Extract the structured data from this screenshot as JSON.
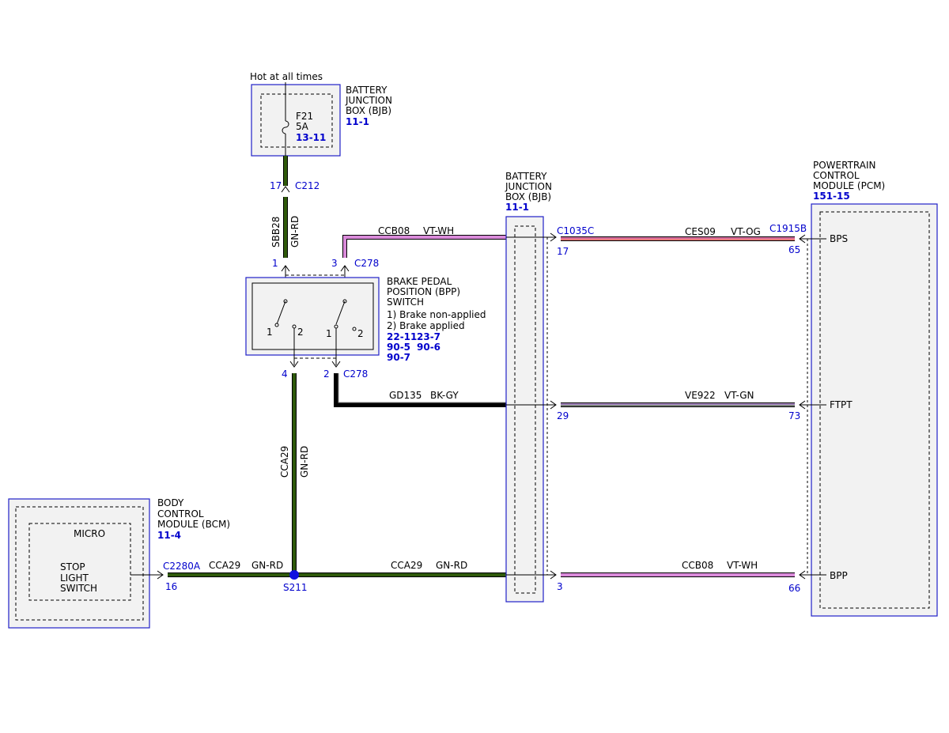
{
  "colors": {
    "gn_rd": "#2f5a0a",
    "vt_wh": "#d98ad9",
    "vt_og": "#e87a7a",
    "vt_gn": "#a686c0",
    "bk_gy": "#000000",
    "module_border": "#2020c8",
    "link_text": "#0000cc",
    "splice": "#1010e0"
  },
  "top_note": "Hot at all times",
  "bjb_top": {
    "name_lines": [
      "BATTERY",
      "JUNCTION",
      "BOX (BJB)"
    ],
    "ref": "11-1",
    "fuse": {
      "id": "F21",
      "rating": "5A",
      "ref": "13-11"
    }
  },
  "bjb_mid": {
    "name_lines": [
      "BATTERY",
      "JUNCTION",
      "BOX (BJB)"
    ],
    "ref": "11-1"
  },
  "pcm": {
    "name_lines": [
      "POWERTRAIN",
      "CONTROL",
      "MODULE (PCM)"
    ],
    "ref": "151-15",
    "pins": [
      "BPS",
      "FTPT",
      "BPP"
    ]
  },
  "bcm": {
    "name_lines": [
      "BODY",
      "CONTROL",
      "MODULE (BCM)"
    ],
    "ref": "11-4",
    "inner_label": "MICRO",
    "switch_lines": [
      "STOP",
      "LIGHT",
      "SWITCH"
    ]
  },
  "bpp": {
    "name_lines": [
      "BRAKE PEDAL",
      "POSITION (BPP)",
      "SWITCH"
    ],
    "states": [
      "1) Brake non-applied",
      "2) Brake applied"
    ],
    "refs": [
      "22-11",
      "23-7",
      "90-5",
      "90-6",
      "90-7"
    ],
    "contact_labels": [
      "1",
      "2",
      "1",
      "2"
    ]
  },
  "connectors": {
    "c212": "C212",
    "c212_pin": "17",
    "c278_top": "C278",
    "c278_pin1": "1",
    "c278_pin3": "3",
    "c278_bottom": "C278",
    "c278_pin4": "4",
    "c278_pin2": "2",
    "c1035c": "C1035C",
    "c1035c_pin17": "17",
    "c1035c_pin29": "29",
    "c1035c_pin3": "3",
    "c1915b": "C1915B",
    "c1915b_pin65": "65",
    "c1915b_pin73": "73",
    "c1915b_pin66": "66",
    "c2280a": "C2280A",
    "c2280a_pin": "16",
    "splice": "S211"
  },
  "wires": {
    "sbb28": {
      "circuit": "SBB28",
      "color": "GN-RD"
    },
    "ccb08_top": {
      "circuit": "CCB08",
      "color": "VT-WH"
    },
    "ces09": {
      "circuit": "CES09",
      "color": "VT-OG"
    },
    "gd135": {
      "circuit": "GD135",
      "color": "BK-GY"
    },
    "ve922": {
      "circuit": "VE922",
      "color": "VT-GN"
    },
    "cca29_vert": {
      "circuit": "CCA29",
      "color": "GN-RD"
    },
    "cca29_left": {
      "circuit": "CCA29",
      "color": "GN-RD"
    },
    "cca29_right": {
      "circuit": "CCA29",
      "color": "GN-RD"
    },
    "ccb08_bottom": {
      "circuit": "CCB08",
      "color": "VT-WH"
    }
  }
}
